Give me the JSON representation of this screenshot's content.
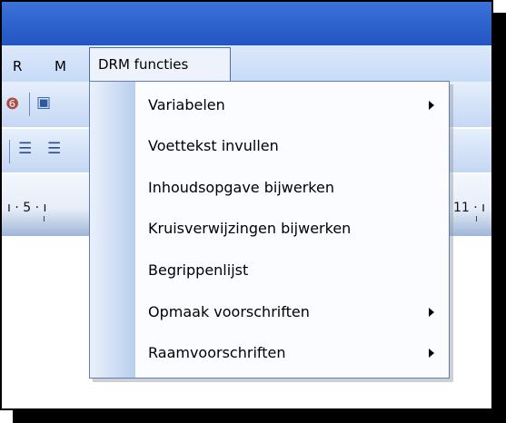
{
  "menubar": {
    "items": [
      {
        "label": "R"
      },
      {
        "label": "M"
      }
    ],
    "active_menu": "DRM functies"
  },
  "ruler": {
    "left_text": "ı · 5 · ı",
    "right_text": "11 · ı"
  },
  "dropdown": {
    "items": [
      {
        "label": "Variabelen",
        "submenu": true,
        "icon": "arrow-right"
      },
      {
        "label": "Voettekst invullen",
        "submenu": false
      },
      {
        "label": "Inhoudsopgave bijwerken",
        "submenu": false
      },
      {
        "label": "Kruisverwijzingen bijwerken",
        "submenu": false
      },
      {
        "label": "Begrippenlijst",
        "submenu": false
      },
      {
        "label": "Opmaak voorschriften",
        "submenu": true,
        "icon": "arrow-right"
      },
      {
        "label": "Raamvoorschriften",
        "submenu": true,
        "icon": "arrow-right"
      }
    ]
  },
  "colors": {
    "title_bar": "#2e63cd",
    "menu_bar": "#d3e3f9",
    "dropdown_strip": "#b9cfee",
    "dropdown_border": "#5d7fb6"
  }
}
